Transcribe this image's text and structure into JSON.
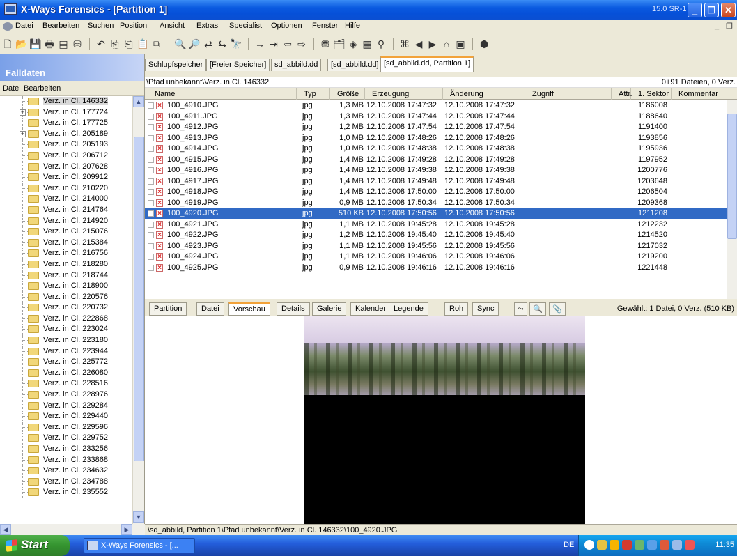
{
  "window": {
    "title": "X-Ways Forensics - [Partition 1]",
    "version": "15.0 SR-1",
    "minimize": "_",
    "maximize": "❐",
    "close": "✕"
  },
  "menubar": {
    "items": [
      "Datei",
      "Bearbeiten",
      "Suchen",
      "Position",
      "Ansicht",
      "Extras",
      "Specialist",
      "Optionen",
      "Fenster",
      "Hilfe"
    ],
    "mdi_min": "_",
    "mdi_restore": "❐"
  },
  "left_panel": {
    "header": "Falldaten",
    "menu": [
      "Datei",
      "Bearbeiten"
    ],
    "tree": [
      {
        "label": "Verz. in Cl. 146332",
        "expandable": false,
        "selected": true
      },
      {
        "label": "Verz. in Cl. 177724",
        "expandable": true,
        "selected": false
      },
      {
        "label": "Verz. in Cl. 177725",
        "expandable": false,
        "selected": false
      },
      {
        "label": "Verz. in Cl. 205189",
        "expandable": true,
        "selected": false
      },
      {
        "label": "Verz. in Cl. 205193",
        "expandable": false,
        "selected": false
      },
      {
        "label": "Verz. in Cl. 206712",
        "expandable": false,
        "selected": false
      },
      {
        "label": "Verz. in Cl. 207628",
        "expandable": false,
        "selected": false
      },
      {
        "label": "Verz. in Cl. 209912",
        "expandable": false,
        "selected": false
      },
      {
        "label": "Verz. in Cl. 210220",
        "expandable": false,
        "selected": false
      },
      {
        "label": "Verz. in Cl. 214000",
        "expandable": false,
        "selected": false
      },
      {
        "label": "Verz. in Cl. 214764",
        "expandable": false,
        "selected": false
      },
      {
        "label": "Verz. in Cl. 214920",
        "expandable": false,
        "selected": false
      },
      {
        "label": "Verz. in Cl. 215076",
        "expandable": false,
        "selected": false
      },
      {
        "label": "Verz. in Cl. 215384",
        "expandable": false,
        "selected": false
      },
      {
        "label": "Verz. in Cl. 216756",
        "expandable": false,
        "selected": false
      },
      {
        "label": "Verz. in Cl. 218280",
        "expandable": false,
        "selected": false
      },
      {
        "label": "Verz. in Cl. 218744",
        "expandable": false,
        "selected": false
      },
      {
        "label": "Verz. in Cl. 218900",
        "expandable": false,
        "selected": false
      },
      {
        "label": "Verz. in Cl. 220576",
        "expandable": false,
        "selected": false
      },
      {
        "label": "Verz. in Cl. 220732",
        "expandable": false,
        "selected": false
      },
      {
        "label": "Verz. in Cl. 222868",
        "expandable": false,
        "selected": false
      },
      {
        "label": "Verz. in Cl. 223024",
        "expandable": false,
        "selected": false
      },
      {
        "label": "Verz. in Cl. 223180",
        "expandable": false,
        "selected": false
      },
      {
        "label": "Verz. in Cl. 223944",
        "expandable": false,
        "selected": false
      },
      {
        "label": "Verz. in Cl. 225772",
        "expandable": false,
        "selected": false
      },
      {
        "label": "Verz. in Cl. 226080",
        "expandable": false,
        "selected": false
      },
      {
        "label": "Verz. in Cl. 228516",
        "expandable": false,
        "selected": false
      },
      {
        "label": "Verz. in Cl. 228976",
        "expandable": false,
        "selected": false
      },
      {
        "label": "Verz. in Cl. 229284",
        "expandable": false,
        "selected": false
      },
      {
        "label": "Verz. in Cl. 229440",
        "expandable": false,
        "selected": false
      },
      {
        "label": "Verz. in Cl. 229596",
        "expandable": false,
        "selected": false
      },
      {
        "label": "Verz. in Cl. 229752",
        "expandable": false,
        "selected": false
      },
      {
        "label": "Verz. in Cl. 233256",
        "expandable": false,
        "selected": false
      },
      {
        "label": "Verz. in Cl. 233868",
        "expandable": false,
        "selected": false
      },
      {
        "label": "Verz. in Cl. 234632",
        "expandable": false,
        "selected": false
      },
      {
        "label": "Verz. in Cl. 234788",
        "expandable": false,
        "selected": false
      },
      {
        "label": "Verz. in Cl. 235552",
        "expandable": false,
        "selected": false
      }
    ]
  },
  "tabs": [
    {
      "label": "Schlupfspeicher",
      "active": false
    },
    {
      "label": "[Freier Speicher]",
      "active": false
    },
    {
      "label": "sd_abbild.dd",
      "active": false
    },
    {
      "label": "[sd_abbild.dd]",
      "active": false
    },
    {
      "label": "[sd_abbild.dd, Partition 1]",
      "active": true
    }
  ],
  "pathbar": {
    "path": "\\Pfad unbekannt\\Verz. in Cl. 146332",
    "count": "0+91 Dateien, 0 Verz."
  },
  "columns": [
    "Name",
    "Typ",
    "Größe",
    "Erzeugung",
    "Änderung",
    "Zugriff",
    "Attr.",
    "1. Sektor",
    "Kommentar"
  ],
  "files": [
    {
      "name": "100_4910.JPG",
      "type": "jpg",
      "size": "1,3 MB",
      "created": "12.10.2008 17:47:32",
      "modified": "12.10.2008 17:47:32",
      "sector": "1186008",
      "selected": false
    },
    {
      "name": "100_4911.JPG",
      "type": "jpg",
      "size": "1,3 MB",
      "created": "12.10.2008 17:47:44",
      "modified": "12.10.2008 17:47:44",
      "sector": "1188640",
      "selected": false
    },
    {
      "name": "100_4912.JPG",
      "type": "jpg",
      "size": "1,2 MB",
      "created": "12.10.2008 17:47:54",
      "modified": "12.10.2008 17:47:54",
      "sector": "1191400",
      "selected": false
    },
    {
      "name": "100_4913.JPG",
      "type": "jpg",
      "size": "1,0 MB",
      "created": "12.10.2008 17:48:26",
      "modified": "12.10.2008 17:48:26",
      "sector": "1193856",
      "selected": false
    },
    {
      "name": "100_4914.JPG",
      "type": "jpg",
      "size": "1,0 MB",
      "created": "12.10.2008 17:48:38",
      "modified": "12.10.2008 17:48:38",
      "sector": "1195936",
      "selected": false
    },
    {
      "name": "100_4915.JPG",
      "type": "jpg",
      "size": "1,4 MB",
      "created": "12.10.2008 17:49:28",
      "modified": "12.10.2008 17:49:28",
      "sector": "1197952",
      "selected": false
    },
    {
      "name": "100_4916.JPG",
      "type": "jpg",
      "size": "1,4 MB",
      "created": "12.10.2008 17:49:38",
      "modified": "12.10.2008 17:49:38",
      "sector": "1200776",
      "selected": false
    },
    {
      "name": "100_4917.JPG",
      "type": "jpg",
      "size": "1,4 MB",
      "created": "12.10.2008 17:49:48",
      "modified": "12.10.2008 17:49:48",
      "sector": "1203648",
      "selected": false
    },
    {
      "name": "100_4918.JPG",
      "type": "jpg",
      "size": "1,4 MB",
      "created": "12.10.2008 17:50:00",
      "modified": "12.10.2008 17:50:00",
      "sector": "1206504",
      "selected": false
    },
    {
      "name": "100_4919.JPG",
      "type": "jpg",
      "size": "0,9 MB",
      "created": "12.10.2008 17:50:34",
      "modified": "12.10.2008 17:50:34",
      "sector": "1209368",
      "selected": false
    },
    {
      "name": "100_4920.JPG",
      "type": "jpg",
      "size": "510 KB",
      "created": "12.10.2008 17:50:56",
      "modified": "12.10.2008 17:50:56",
      "sector": "1211208",
      "selected": true
    },
    {
      "name": "100_4921.JPG",
      "type": "jpg",
      "size": "1,1 MB",
      "created": "12.10.2008 19:45:28",
      "modified": "12.10.2008 19:45:28",
      "sector": "1212232",
      "selected": false
    },
    {
      "name": "100_4922.JPG",
      "type": "jpg",
      "size": "1,2 MB",
      "created": "12.10.2008 19:45:40",
      "modified": "12.10.2008 19:45:40",
      "sector": "1214520",
      "selected": false
    },
    {
      "name": "100_4923.JPG",
      "type": "jpg",
      "size": "1,1 MB",
      "created": "12.10.2008 19:45:56",
      "modified": "12.10.2008 19:45:56",
      "sector": "1217032",
      "selected": false
    },
    {
      "name": "100_4924.JPG",
      "type": "jpg",
      "size": "1,1 MB",
      "created": "12.10.2008 19:46:06",
      "modified": "12.10.2008 19:46:06",
      "sector": "1219200",
      "selected": false
    },
    {
      "name": "100_4925.JPG",
      "type": "jpg",
      "size": "0,9 MB",
      "created": "12.10.2008 19:46:16",
      "modified": "12.10.2008 19:46:16",
      "sector": "1221448",
      "selected": false
    }
  ],
  "view_tabs": [
    {
      "label": "Partition",
      "active": false
    },
    {
      "label": "Datei",
      "active": false
    },
    {
      "label": "Vorschau",
      "active": true
    },
    {
      "label": "Details",
      "active": false
    },
    {
      "label": "Galerie",
      "active": false
    },
    {
      "label": "Kalender",
      "active": false
    },
    {
      "label": "Legende",
      "active": false
    },
    {
      "label": "Roh",
      "active": false
    },
    {
      "label": "Sync",
      "active": false
    }
  ],
  "selection_info": "Gewählt: 1 Datei, 0 Verz. (510 KB)",
  "status_path": "\\sd_abbild, Partition 1\\Pfad unbekannt\\Verz. in Cl. 146332\\100_4920.JPG",
  "taskbar": {
    "start": "Start",
    "task": "X-Ways Forensics - [...",
    "lang": "DE",
    "clock": "11:35"
  },
  "colors": {
    "titlebar": "#0a5ae0",
    "selection": "#316ac5",
    "tab_accent": "#f2a23a",
    "taskbar": "#245edb"
  }
}
